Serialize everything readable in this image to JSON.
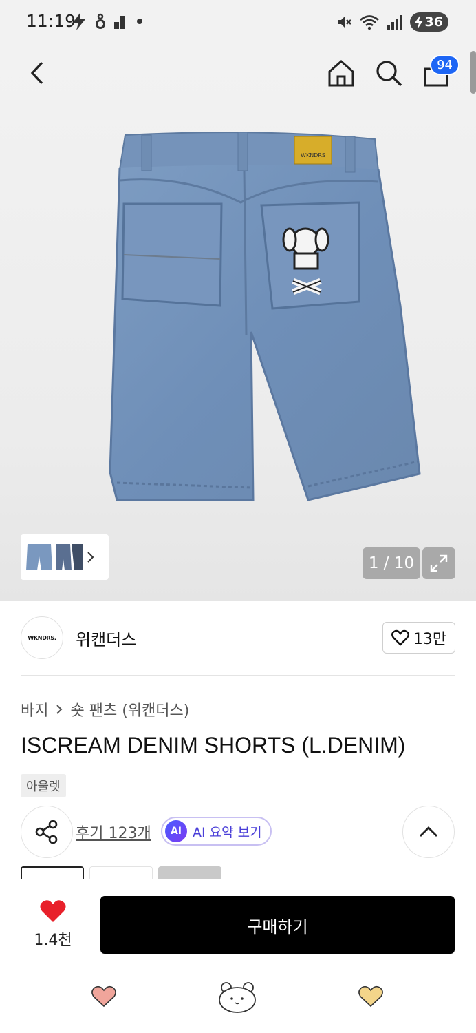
{
  "status_bar": {
    "time": "11:19",
    "battery": "36",
    "left_icons": [
      "bolt-icon",
      "lock-person-icon",
      "signal-bars-icon",
      "dot-icon"
    ],
    "right_icons": [
      "mute-icon",
      "wifi-icon",
      "cell-signal-icon",
      "battery-icon"
    ]
  },
  "nav": {
    "back_icon": "chevron-left-icon",
    "home_icon": "home-icon",
    "search_icon": "search-icon",
    "cart_icon": "shopping-bag-icon",
    "cart_count": "94"
  },
  "gallery": {
    "page_indicator": "1 / 10",
    "image_alt": "light denim shorts back view",
    "thumbnail_label": ""
  },
  "brand": {
    "logo_text": "WKNDRS.",
    "name": "위캔더스",
    "like_count": "13만"
  },
  "breadcrumb": {
    "items": [
      "바지",
      "숏 팬츠 (위캔더스)"
    ]
  },
  "product": {
    "title": "ISCREAM DENIM SHORTS (L.DENIM)",
    "tag": "아울렛"
  },
  "actions": {
    "review_link": "후기 123개",
    "ai_badge": "AI",
    "ai_summary": "AI 요약 보기"
  },
  "bottom": {
    "wish_count": "1.4천",
    "buy_label": "구매하기"
  },
  "colors": {
    "accent_blue": "#1e66f5",
    "heart_red": "#e8202a",
    "buy_button": "#000000",
    "ai_purple": "#4a3fd8"
  }
}
